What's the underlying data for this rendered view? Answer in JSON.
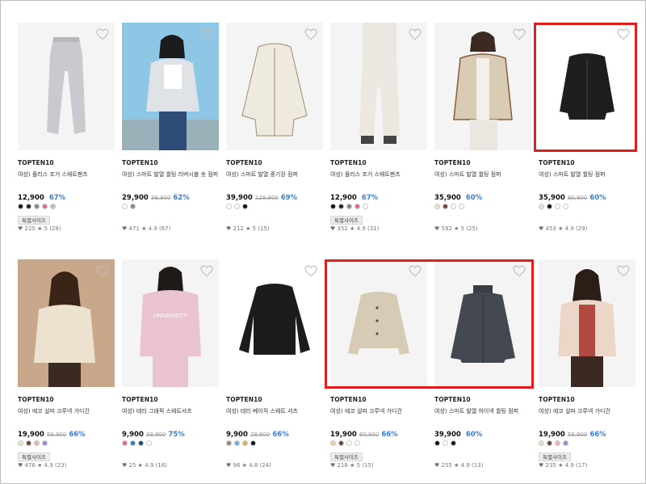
{
  "colors": {
    "accent_discount": "#3b7dd8",
    "highlight_border": "#e01e1e",
    "image_bg": "#f1f1f1"
  },
  "rows": [
    {
      "products": [
        {
          "brand": "TOPTEN10",
          "name": "여성) 플리스 조거 스웨트팬츠",
          "price": "12,900",
          "original": "",
          "discount": "67%",
          "swatches": [
            "#111111",
            "#222222",
            "#888888",
            "#e06a8a",
            "#bdbdbd"
          ],
          "badge": "특별사이즈",
          "likes": "220",
          "rating": "5 (28)",
          "image": "grey-jogger-pants",
          "heart_icon": "heart-outline-icon"
        },
        {
          "brand": "TOPTEN10",
          "name": "여성) 스마트 발열 퀼팅 리버시블 숏 점퍼",
          "price": "29,900",
          "original": "39,900",
          "discount": "62%",
          "swatches": [
            "#ffffff",
            "#888888"
          ],
          "badge": "",
          "likes": "471",
          "rating": "4.9 (67)",
          "image": "model-quilted-reversible-jacket",
          "heart_icon": "heart-outline-icon"
        },
        {
          "brand": "TOPTEN10",
          "name": "여성) 스마트 발열 중기장 점퍼",
          "price": "39,900",
          "original": "129,900",
          "discount": "69%",
          "swatches": [
            "#ffffff",
            "#ffffff",
            "#111111"
          ],
          "badge": "",
          "likes": "212",
          "rating": "5 (15)",
          "image": "ivory-quilted-long-jacket",
          "heart_icon": "heart-outline-icon"
        },
        {
          "brand": "TOPTEN10",
          "name": "여성) 플리스 조거 스웨트팬츠",
          "price": "12,900",
          "original": "",
          "discount": "67%",
          "swatches": [
            "#111111",
            "#222222",
            "#888888",
            "#e06a8a",
            "#ffffff"
          ],
          "badge": "특별사이즈",
          "likes": "352",
          "rating": "4.9 (31)",
          "image": "model-ivory-jogger-pants",
          "heart_icon": "heart-outline-icon"
        },
        {
          "brand": "TOPTEN10",
          "name": "여성) 스마트 발열 퀼팅 점퍼",
          "price": "35,900",
          "original": "",
          "discount": "60%",
          "swatches": [
            "#e8e1cf",
            "#6b4a33",
            "#ffffff",
            "#ffffff"
          ],
          "badge": "",
          "likes": "592",
          "rating": "5 (25)",
          "image": "model-beige-quilted-jacket",
          "heart_icon": "heart-outline-icon"
        },
        {
          "brand": "TOPTEN10",
          "name": "여성) 스마트 발열 퀼팅 점퍼",
          "price": "35,900",
          "original": "80,900",
          "discount": "60%",
          "swatches": [
            "#e8e1cf",
            "#111111",
            "#ffffff",
            "#ffffff"
          ],
          "badge": "",
          "likes": "453",
          "rating": "4.9 (29)",
          "image": "black-quilted-jacket",
          "heart_icon": "heart-outline-icon"
        }
      ]
    },
    {
      "products": [
        {
          "brand": "TOPTEN10",
          "name": "여성) 에코 설파 크루넥 가디건",
          "price": "19,900",
          "original": "59,900",
          "discount": "66%",
          "swatches": [
            "#e8e1cf",
            "#6b4a33",
            "#e8b0c0",
            "#9e8ad0"
          ],
          "badge": "특별사이즈",
          "likes": "476",
          "rating": "4.9 (23)",
          "image": "model-fleece-cardigan-cream",
          "heart_icon": "heart-outline-icon"
        },
        {
          "brand": "TOPTEN10",
          "name": "여성) 테리 그래픽 스웨트셔츠",
          "price": "9,900",
          "original": "39,900",
          "discount": "75%",
          "swatches": [
            "#e06a8a",
            "#2d7fbf",
            "#1c4a6e",
            "#ffffff"
          ],
          "badge": "",
          "likes": "25",
          "rating": "4.9 (16)",
          "image": "model-pink-sweatshirt",
          "heart_icon": "heart-outline-icon"
        },
        {
          "brand": "TOPTEN10",
          "name": "여성) 테리 베이직 스웨트 셔츠",
          "price": "9,900",
          "original": "29,900",
          "discount": "66%",
          "swatches": [
            "#8a8a8a",
            "#6fb0e0",
            "#d9b44a",
            "#111111"
          ],
          "badge": "",
          "likes": "96",
          "rating": "4.8 (24)",
          "image": "black-sweatshirt",
          "heart_icon": "heart-outline-icon"
        },
        {
          "brand": "TOPTEN10",
          "name": "여성) 에코 설파 크루넥 가디건",
          "price": "19,900",
          "original": "60,900",
          "discount": "66%",
          "swatches": [
            "#e8d0a8",
            "#6b4a33",
            "#ffffff",
            "#ffffff"
          ],
          "badge": "특별사이즈",
          "likes": "218",
          "rating": "5 (15)",
          "image": "beige-crop-cardigan",
          "heart_icon": "heart-outline-icon"
        },
        {
          "brand": "TOPTEN10",
          "name": "여성) 스마트 발열 하이넥 퀼팅 점퍼",
          "price": "39,900",
          "original": "",
          "discount": "60%",
          "swatches": [
            "#111111",
            "#ffffff",
            "#111111"
          ],
          "badge": "",
          "likes": "255",
          "rating": "4.9 (13)",
          "image": "charcoal-highneck-quilted-jacket",
          "heart_icon": "heart-outline-icon"
        },
        {
          "brand": "TOPTEN10",
          "name": "여성) 에코 설파 크루넥 가디건",
          "price": "19,900",
          "original": "59,900",
          "discount": "66%",
          "swatches": [
            "#e8e1cf",
            "#6b4a33",
            "#e8b0c0",
            "#9e8ad0"
          ],
          "badge": "특별사이즈",
          "likes": "235",
          "rating": "4.9 (17)",
          "image": "model-fleece-cardigan-pink",
          "heart_icon": "heart-outline-icon"
        }
      ]
    }
  ]
}
